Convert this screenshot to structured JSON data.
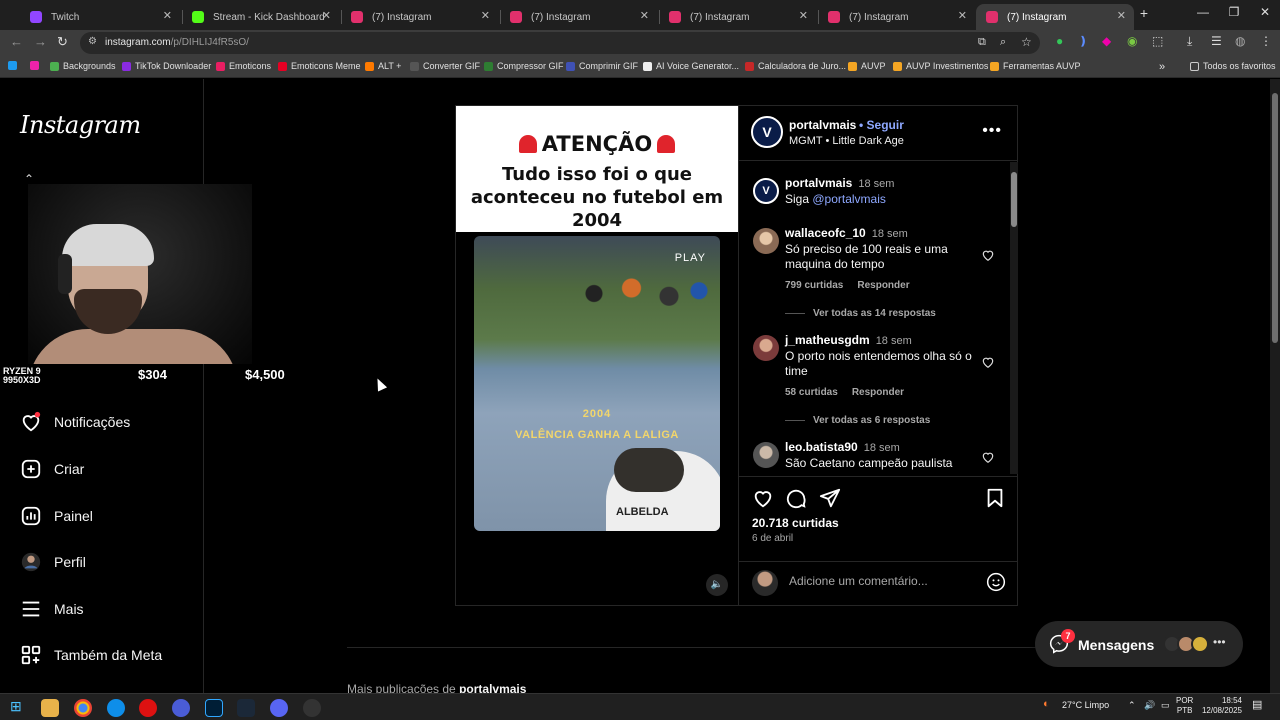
{
  "browser": {
    "tabs": [
      {
        "title": "Twitch",
        "color": "#9146ff"
      },
      {
        "title": "Stream - Kick Dashboard",
        "color": "#53fc18"
      },
      {
        "title": "(7) Instagram",
        "color": "#e1306c"
      },
      {
        "title": "(7) Instagram",
        "color": "#e1306c"
      },
      {
        "title": "(7) Instagram",
        "color": "#e1306c"
      },
      {
        "title": "(7) Instagram",
        "color": "#e1306c"
      },
      {
        "title": "(7) Instagram",
        "color": "#e1306c"
      }
    ],
    "url_host": "instagram.com",
    "url_path": "/p/DIHLIJ4fR5sO/",
    "bookmarks": [
      "Backgrounds",
      "TikTok Downloader",
      "Emoticons",
      "Emoticons Meme",
      "ALT +",
      "Converter GIF",
      "Compressor GIF",
      "Comprimir GIF",
      "AI Voice Generator...",
      "Calculadora de Juro...",
      "AUVP",
      "AUVP Investimentos",
      "Ferramentas AUVP"
    ],
    "all_bookmarks": "Todos os favoritos"
  },
  "sidebar": {
    "logo": "Instagram",
    "overlay": {
      "ryzen_line1": "RYZEN 9",
      "ryzen_line2": "9950X3D",
      "price_left": "$304",
      "price_right": "$4,500"
    },
    "nav": [
      {
        "label": "Notificações",
        "icon": "heart-icon"
      },
      {
        "label": "Criar",
        "icon": "plus-square-icon"
      },
      {
        "label": "Painel",
        "icon": "chart-icon"
      },
      {
        "label": "Perfil",
        "icon": "avatar"
      },
      {
        "label": "Mais",
        "icon": "menu-icon"
      },
      {
        "label": "Também da Meta",
        "icon": "threads-icon"
      }
    ]
  },
  "post": {
    "video": {
      "title_line1": "ATENÇÃO",
      "title_line2": "Tudo isso foi o que aconteceu no futebol em 2004",
      "play_label": "PLAY",
      "year": "2004",
      "caption": "VALÊNCIA GANHA A LALIGA",
      "player_name": "ALBELDA"
    },
    "author": "portalvmais",
    "avatar_letter": "V",
    "follow_label": "Seguir",
    "music": "MGMT • Little Dark Age",
    "caption": {
      "user": "portalvmais",
      "time": "18 sem",
      "text_prefix": "Siga ",
      "mention": "@portalvmais"
    },
    "comments": [
      {
        "user": "wallaceofc_10",
        "time": "18 sem",
        "text": "Só preciso de 100 reais e uma maquina do tempo",
        "likes": "799 curtidas",
        "reply": "Responder",
        "view_replies": "Ver todas as 14 respostas"
      },
      {
        "user": "j_matheusgdm",
        "time": "18 sem",
        "text": "O porto nois entendemos olha só o time",
        "likes": "58 curtidas",
        "reply": "Responder",
        "view_replies": "Ver todas as 6 respostas"
      },
      {
        "user": "leo.batista90",
        "time": "18 sem",
        "text": "São Caetano campeão paulista"
      }
    ],
    "likes": "20.718 curtidas",
    "date": "6 de abril",
    "comment_placeholder": "Adicione um comentário..."
  },
  "more_posts": {
    "prefix": "Mais publicações de ",
    "user": "portalvmais"
  },
  "messages": {
    "label": "Mensagens",
    "badge": "7"
  },
  "taskbar": {
    "weather": "27°C Limpo",
    "lang1": "POR",
    "lang2": "PTB",
    "time": "18:54",
    "date": "12/08/2025"
  },
  "colors": {
    "accent_link": "#8ea8ff",
    "badge": "#ff3040",
    "background": "#000000"
  }
}
